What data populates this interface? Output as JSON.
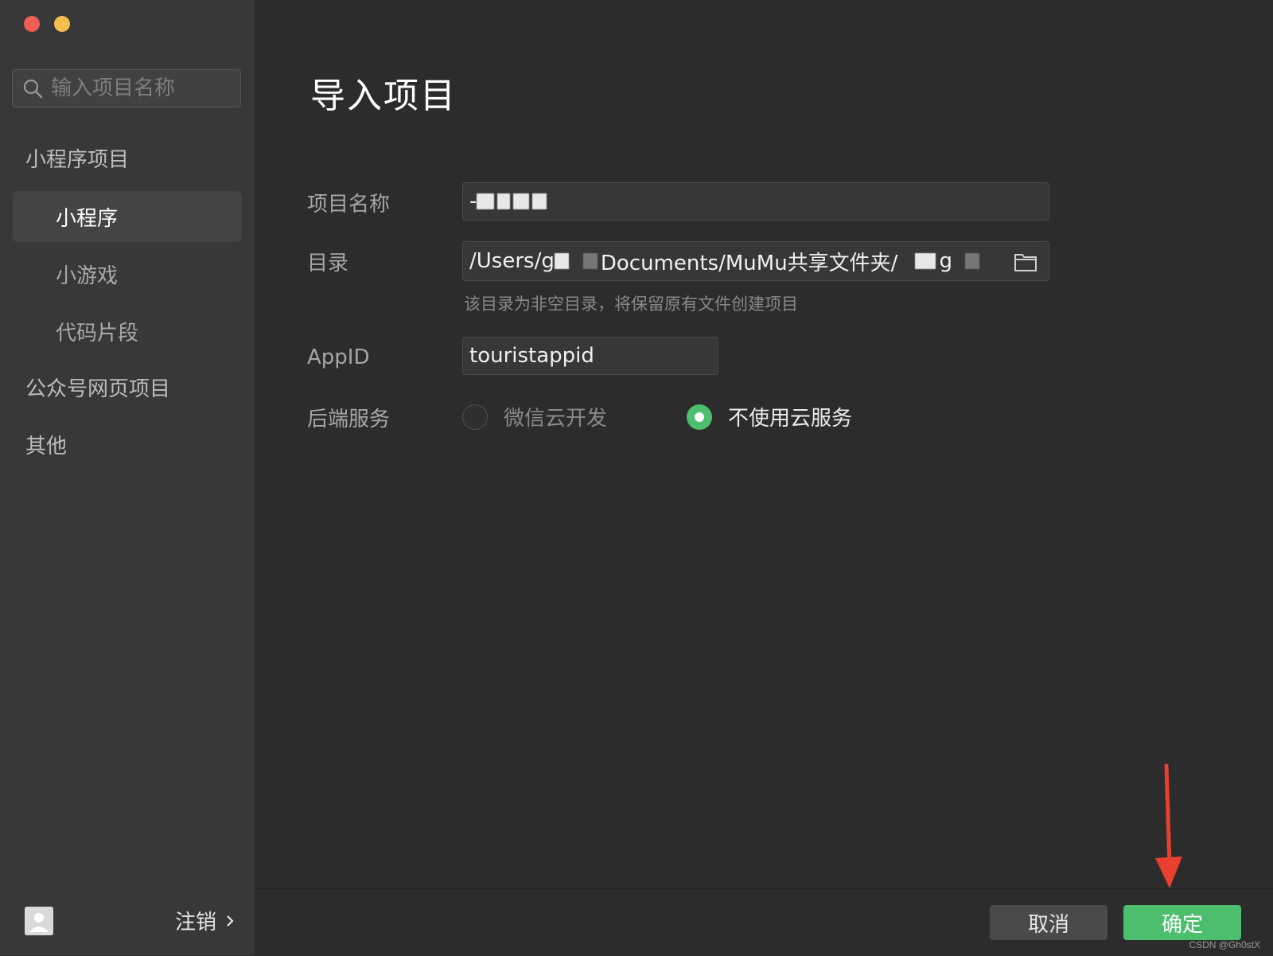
{
  "window": {
    "traffic_lights": {
      "close_color": "#ee5e57",
      "minimize_color": "#f4be4f"
    }
  },
  "sidebar": {
    "search": {
      "placeholder": "输入项目名称",
      "icon": "search-icon"
    },
    "groups": [
      {
        "label": "小程序项目"
      },
      {
        "label": "公众号网页项目"
      },
      {
        "label": "其他"
      }
    ],
    "items": [
      {
        "label": "小程序",
        "active": true
      },
      {
        "label": "小游戏",
        "active": false
      },
      {
        "label": "代码片段",
        "active": false
      }
    ],
    "user": {
      "logout_label": "注销",
      "avatar_icon": "user-avatar-icon"
    }
  },
  "main": {
    "title": "导入项目",
    "project_name": {
      "label": "项目名称",
      "value": "-"
    },
    "directory": {
      "label": "目录",
      "value_prefix": "/Users/g",
      "value_middle": "Documents/MuMu共享文件夹/",
      "value_suffix": "g",
      "hint": "该目录为非空目录，将保留原有文件创建项目",
      "folder_icon": "folder-icon"
    },
    "appid": {
      "label": "AppID",
      "value": "touristappid"
    },
    "backend": {
      "label": "后端服务",
      "options": [
        {
          "label": "微信云开发",
          "selected": false
        },
        {
          "label": "不使用云服务",
          "selected": true
        }
      ]
    }
  },
  "footer": {
    "cancel_label": "取消",
    "confirm_label": "确定"
  },
  "watermark": "CSDN @Gh0stX",
  "colors": {
    "accent": "#4cbe6d",
    "arrow": "#e8402f"
  }
}
